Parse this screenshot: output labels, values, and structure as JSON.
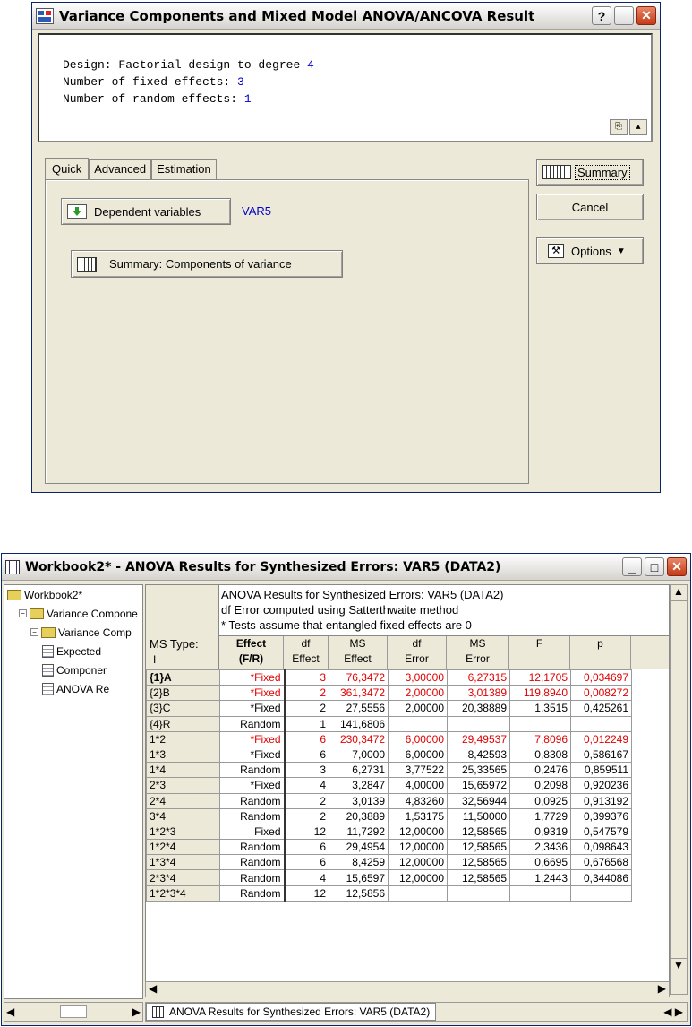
{
  "dialog": {
    "title": "Variance Components and Mixed Model ANOVA/ANCOVA Result",
    "help_label": "?",
    "info_lines": [
      {
        "label": "Design: Factorial design to degree ",
        "value": "4"
      },
      {
        "label": "Number of fixed effects: ",
        "value": "3"
      },
      {
        "label": "Number of random effects: ",
        "value": "1"
      }
    ],
    "tabs": [
      "Quick",
      "Advanced",
      "Estimation"
    ],
    "dependent_button": "Dependent variables",
    "dependent_value": "VAR5",
    "components_button": "Summary:  Components of variance",
    "summary_button": "Summary",
    "cancel_button": "Cancel",
    "options_button": "Options"
  },
  "workbook": {
    "title": "Workbook2* - ANOVA Results for Synthesized Errors: VAR5 (DATA2)",
    "tree": [
      {
        "label": "Workbook2*",
        "level": 0,
        "kind": "folder"
      },
      {
        "label": "Variance Compone",
        "level": 1,
        "kind": "folder"
      },
      {
        "label": "Variance Comp",
        "level": 2,
        "kind": "folder"
      },
      {
        "label": "Expected",
        "level": 3,
        "kind": "doc"
      },
      {
        "label": "Componer",
        "level": 3,
        "kind": "doc"
      },
      {
        "label": "ANOVA Re",
        "level": 3,
        "kind": "doc"
      }
    ],
    "sheet_header": [
      "ANOVA Results for Synthesized Errors: VAR5 (DATA2)",
      "df Error computed using Satterthwaite method",
      "* Tests assume that entangled fixed effects are 0"
    ],
    "corner_label_1": "MS Type:",
    "corner_label_2": "I",
    "columns": [
      {
        "top": "Effect",
        "bottom": "(F/R)",
        "bold": true
      },
      {
        "top": "df",
        "bottom": "Effect"
      },
      {
        "top": "MS",
        "bottom": "Effect"
      },
      {
        "top": "df",
        "bottom": "Error"
      },
      {
        "top": "MS",
        "bottom": "Error"
      },
      {
        "top": "F",
        "bottom": ""
      },
      {
        "top": "p",
        "bottom": ""
      }
    ],
    "rows": [
      {
        "label": "{1}A",
        "cells": [
          "*Fixed",
          "3",
          "76,3472",
          "3,00000",
          "6,27315",
          "12,1705",
          "0,034697"
        ],
        "highlight": true,
        "bold": true
      },
      {
        "label": "{2}B",
        "cells": [
          "*Fixed",
          "2",
          "361,3472",
          "2,00000",
          "3,01389",
          "119,8940",
          "0,008272"
        ],
        "highlight": true
      },
      {
        "label": "{3}C",
        "cells": [
          "*Fixed",
          "2",
          "27,5556",
          "2,00000",
          "20,38889",
          "1,3515",
          "0,425261"
        ]
      },
      {
        "label": "{4}R",
        "cells": [
          "Random",
          "1",
          "141,6806",
          "",
          "",
          "",
          ""
        ]
      },
      {
        "label": "1*2",
        "cells": [
          "*Fixed",
          "6",
          "230,3472",
          "6,00000",
          "29,49537",
          "7,8096",
          "0,012249"
        ],
        "highlight": true
      },
      {
        "label": "1*3",
        "cells": [
          "*Fixed",
          "6",
          "7,0000",
          "6,00000",
          "8,42593",
          "0,8308",
          "0,586167"
        ]
      },
      {
        "label": "1*4",
        "cells": [
          "Random",
          "3",
          "6,2731",
          "3,77522",
          "25,33565",
          "0,2476",
          "0,859511"
        ]
      },
      {
        "label": "2*3",
        "cells": [
          "*Fixed",
          "4",
          "3,2847",
          "4,00000",
          "15,65972",
          "0,2098",
          "0,920236"
        ]
      },
      {
        "label": "2*4",
        "cells": [
          "Random",
          "2",
          "3,0139",
          "4,83260",
          "32,56944",
          "0,0925",
          "0,913192"
        ]
      },
      {
        "label": "3*4",
        "cells": [
          "Random",
          "2",
          "20,3889",
          "1,53175",
          "11,50000",
          "1,7729",
          "0,399376"
        ]
      },
      {
        "label": "1*2*3",
        "cells": [
          "Fixed",
          "12",
          "11,7292",
          "12,00000",
          "12,58565",
          "0,9319",
          "0,547579"
        ]
      },
      {
        "label": "1*2*4",
        "cells": [
          "Random",
          "6",
          "29,4954",
          "12,00000",
          "12,58565",
          "2,3436",
          "0,098643"
        ]
      },
      {
        "label": "1*3*4",
        "cells": [
          "Random",
          "6",
          "8,4259",
          "12,00000",
          "12,58565",
          "0,6695",
          "0,676568"
        ]
      },
      {
        "label": "2*3*4",
        "cells": [
          "Random",
          "4",
          "15,6597",
          "12,00000",
          "12,58565",
          "1,2443",
          "0,344086"
        ]
      },
      {
        "label": "1*2*3*4",
        "cells": [
          "Random",
          "12",
          "12,5856",
          "",
          "",
          "",
          ""
        ]
      }
    ],
    "sheet_tab": "ANOVA Results for Synthesized Errors: VAR5 (DATA2)",
    "colors": {
      "highlight": "#e00000",
      "link": "#0000cc",
      "title_border": "#0a246a"
    }
  }
}
